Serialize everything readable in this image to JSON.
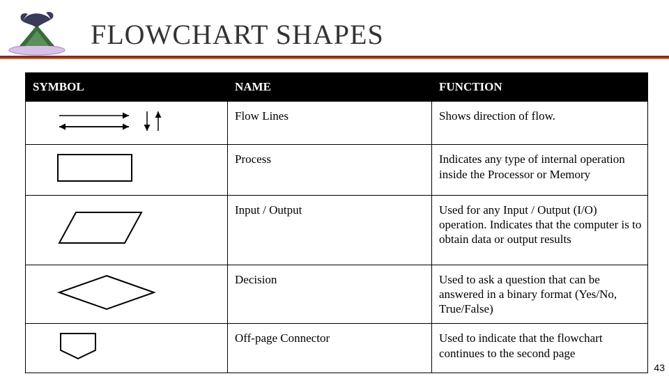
{
  "title": "FLOWCHART SHAPES",
  "page_number": "43",
  "headers": {
    "symbol": "SYMBOL",
    "name": "NAME",
    "function": "FUNCTION"
  },
  "rows": [
    {
      "name": "Flow Lines",
      "function": "Shows direction of flow.",
      "symbol": "flow-lines-icon"
    },
    {
      "name": "Process",
      "function": "Indicates any type of internal operation inside the Processor or Memory",
      "symbol": "process-icon"
    },
    {
      "name": "Input / Output",
      "function": "Used for any Input / Output (I/O) operation. Indicates that the computer is to obtain data or output results",
      "symbol": "io-parallelogram-icon"
    },
    {
      "name": "Decision",
      "function": "Used to ask a question that can be answered in a binary format (Yes/No, True/False)",
      "symbol": "decision-diamond-icon"
    },
    {
      "name": "Off-page Connector",
      "function": "Used to indicate that the flowchart continues to the second page",
      "symbol": "offpage-connector-icon"
    }
  ]
}
